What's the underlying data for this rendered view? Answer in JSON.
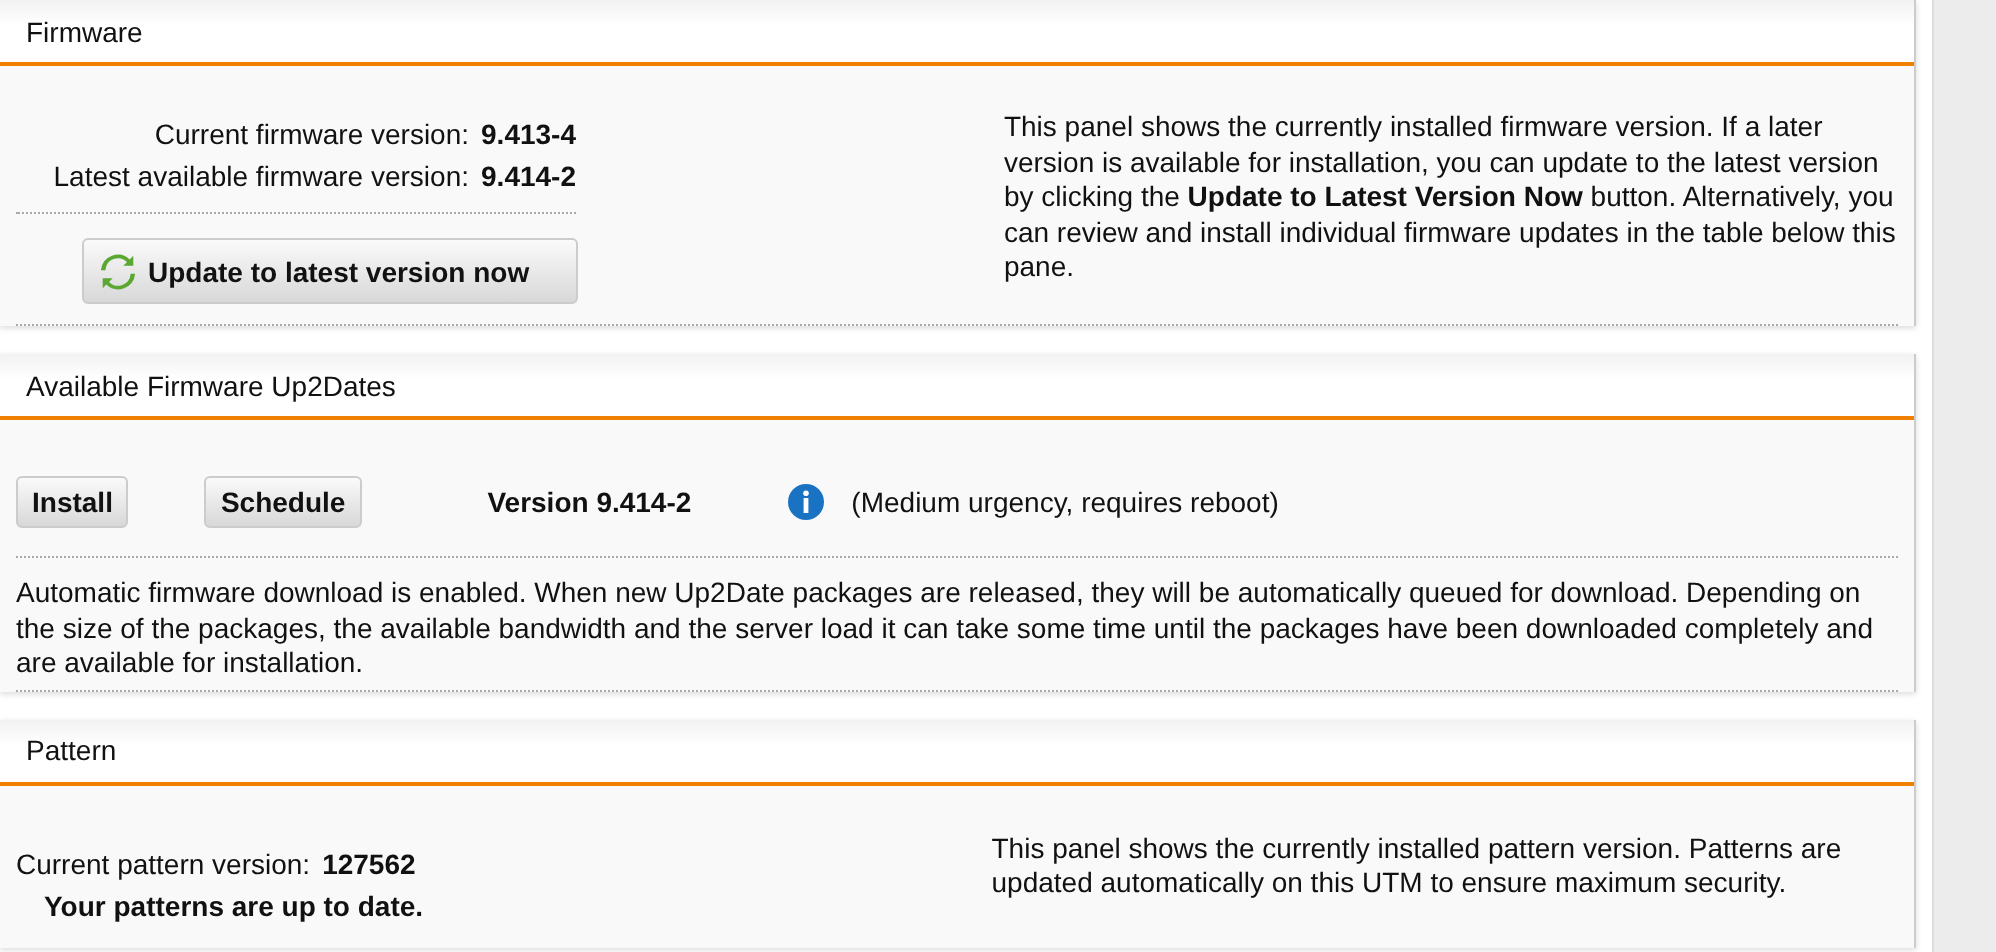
{
  "firmware": {
    "title": "Firmware",
    "fields": [
      {
        "label": "Current firmware version:",
        "value": "9.413-4"
      },
      {
        "label": "Latest available firmware version:",
        "value": "9.414-2"
      }
    ],
    "update_button": "Update to latest version now",
    "description": "This panel shows the currently installed firmware version. If a later version is available for installation, you can update to the latest version by clicking the **Update to Latest Version Now** button. Alternatively, you can review and install individual firmware updates in the table below this pane."
  },
  "up2dates": {
    "title": "Available Firmware Up2Dates",
    "buttons": [
      "Install",
      "Schedule"
    ],
    "version": "Version 9.414-2",
    "note": "(Medium urgency, requires reboot)",
    "description": "Automatic firmware download is enabled. When new Up2Date packages are released, they will be automatically queued for download. Depending on the size of the packages, the available bandwidth and the server load it can take some time until the packages have been downloaded completely and are available for installation."
  },
  "pattern": {
    "title": "Pattern",
    "fields": [
      {
        "label": "Current pattern version:",
        "value": "127562"
      }
    ],
    "status": "Your patterns are up to date.",
    "description": "This panel shows the currently installed pattern version. Patterns are updated automatically on this UTM to ensure maximum security."
  }
}
